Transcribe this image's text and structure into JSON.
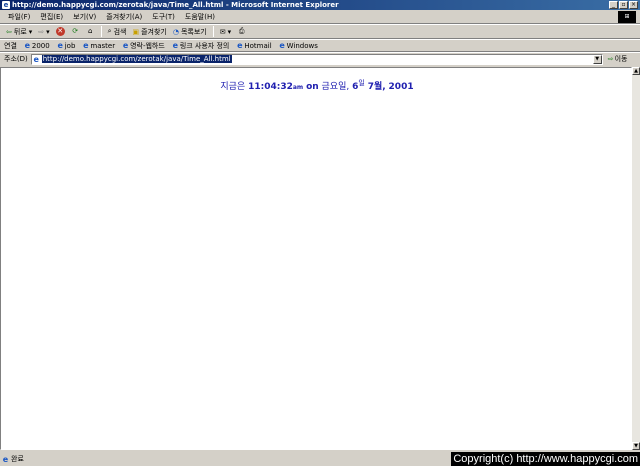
{
  "window": {
    "title": "http://demo.happycgi.com/zerotak/java/Time_All.html - Microsoft Internet Explorer",
    "buttons": [
      "_",
      "▫",
      "×"
    ]
  },
  "menu": [
    "파일(F)",
    "편집(E)",
    "보기(V)",
    "즐겨찾기(A)",
    "도구(T)",
    "도움말(H)"
  ],
  "toolbar": {
    "back": "뒤로",
    "search": "검색",
    "favorites": "즐겨찾기",
    "history": "목록보기"
  },
  "links": {
    "label": "연결",
    "items": [
      "2000",
      "job",
      "master",
      "영락-웹하드",
      "링크 사용자 정의",
      "Hotmail",
      "Windows"
    ]
  },
  "address": {
    "label": "주소(D)",
    "url": "http://demo.happycgi.com/zerotak/java/Time_All.html",
    "go": "이동"
  },
  "clock": {
    "prefix": "지금은",
    "time": "11:04:32",
    "ampm": "am",
    "on": "on",
    "weekday": "금요일,",
    "day": "6",
    "day_suffix": "일",
    "month": "7월,",
    "year": "2001"
  },
  "status": {
    "text": "완료",
    "copyright": "Copyright(c) http://www.happycgi.com"
  }
}
